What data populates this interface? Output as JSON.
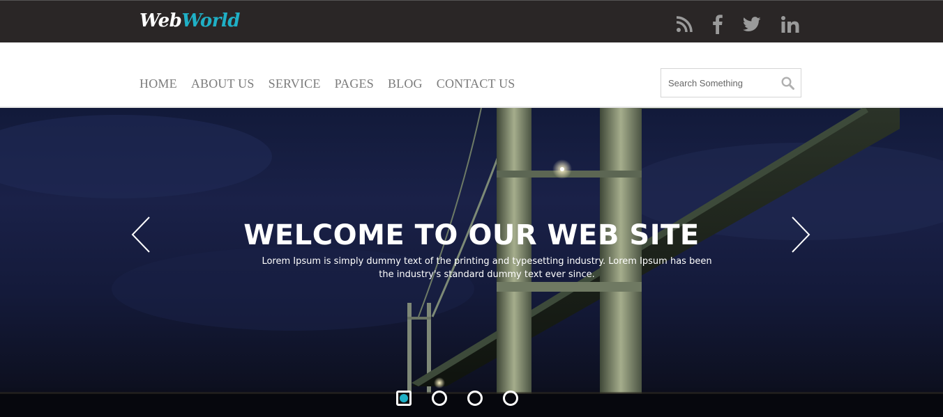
{
  "brand": {
    "part1": "Web",
    "part2": "World",
    "accent": "#1fb0c6"
  },
  "social": [
    "rss-icon",
    "facebook-icon",
    "twitter-icon",
    "linkedin-icon"
  ],
  "nav": {
    "items": [
      "HOME",
      "ABOUT US",
      "SERVICE",
      "PAGES",
      "BLOG",
      "CONTACT US"
    ]
  },
  "search": {
    "placeholder": "Search Something",
    "value": ""
  },
  "hero": {
    "title": "WELCOME TO OUR WEB SITE",
    "text": "Lorem Ipsum is simply dummy text of the printing and typesetting industry. Lorem Ipsum has been the industry's standard dummy text ever since.",
    "slides": 4,
    "active_slide": 1
  }
}
